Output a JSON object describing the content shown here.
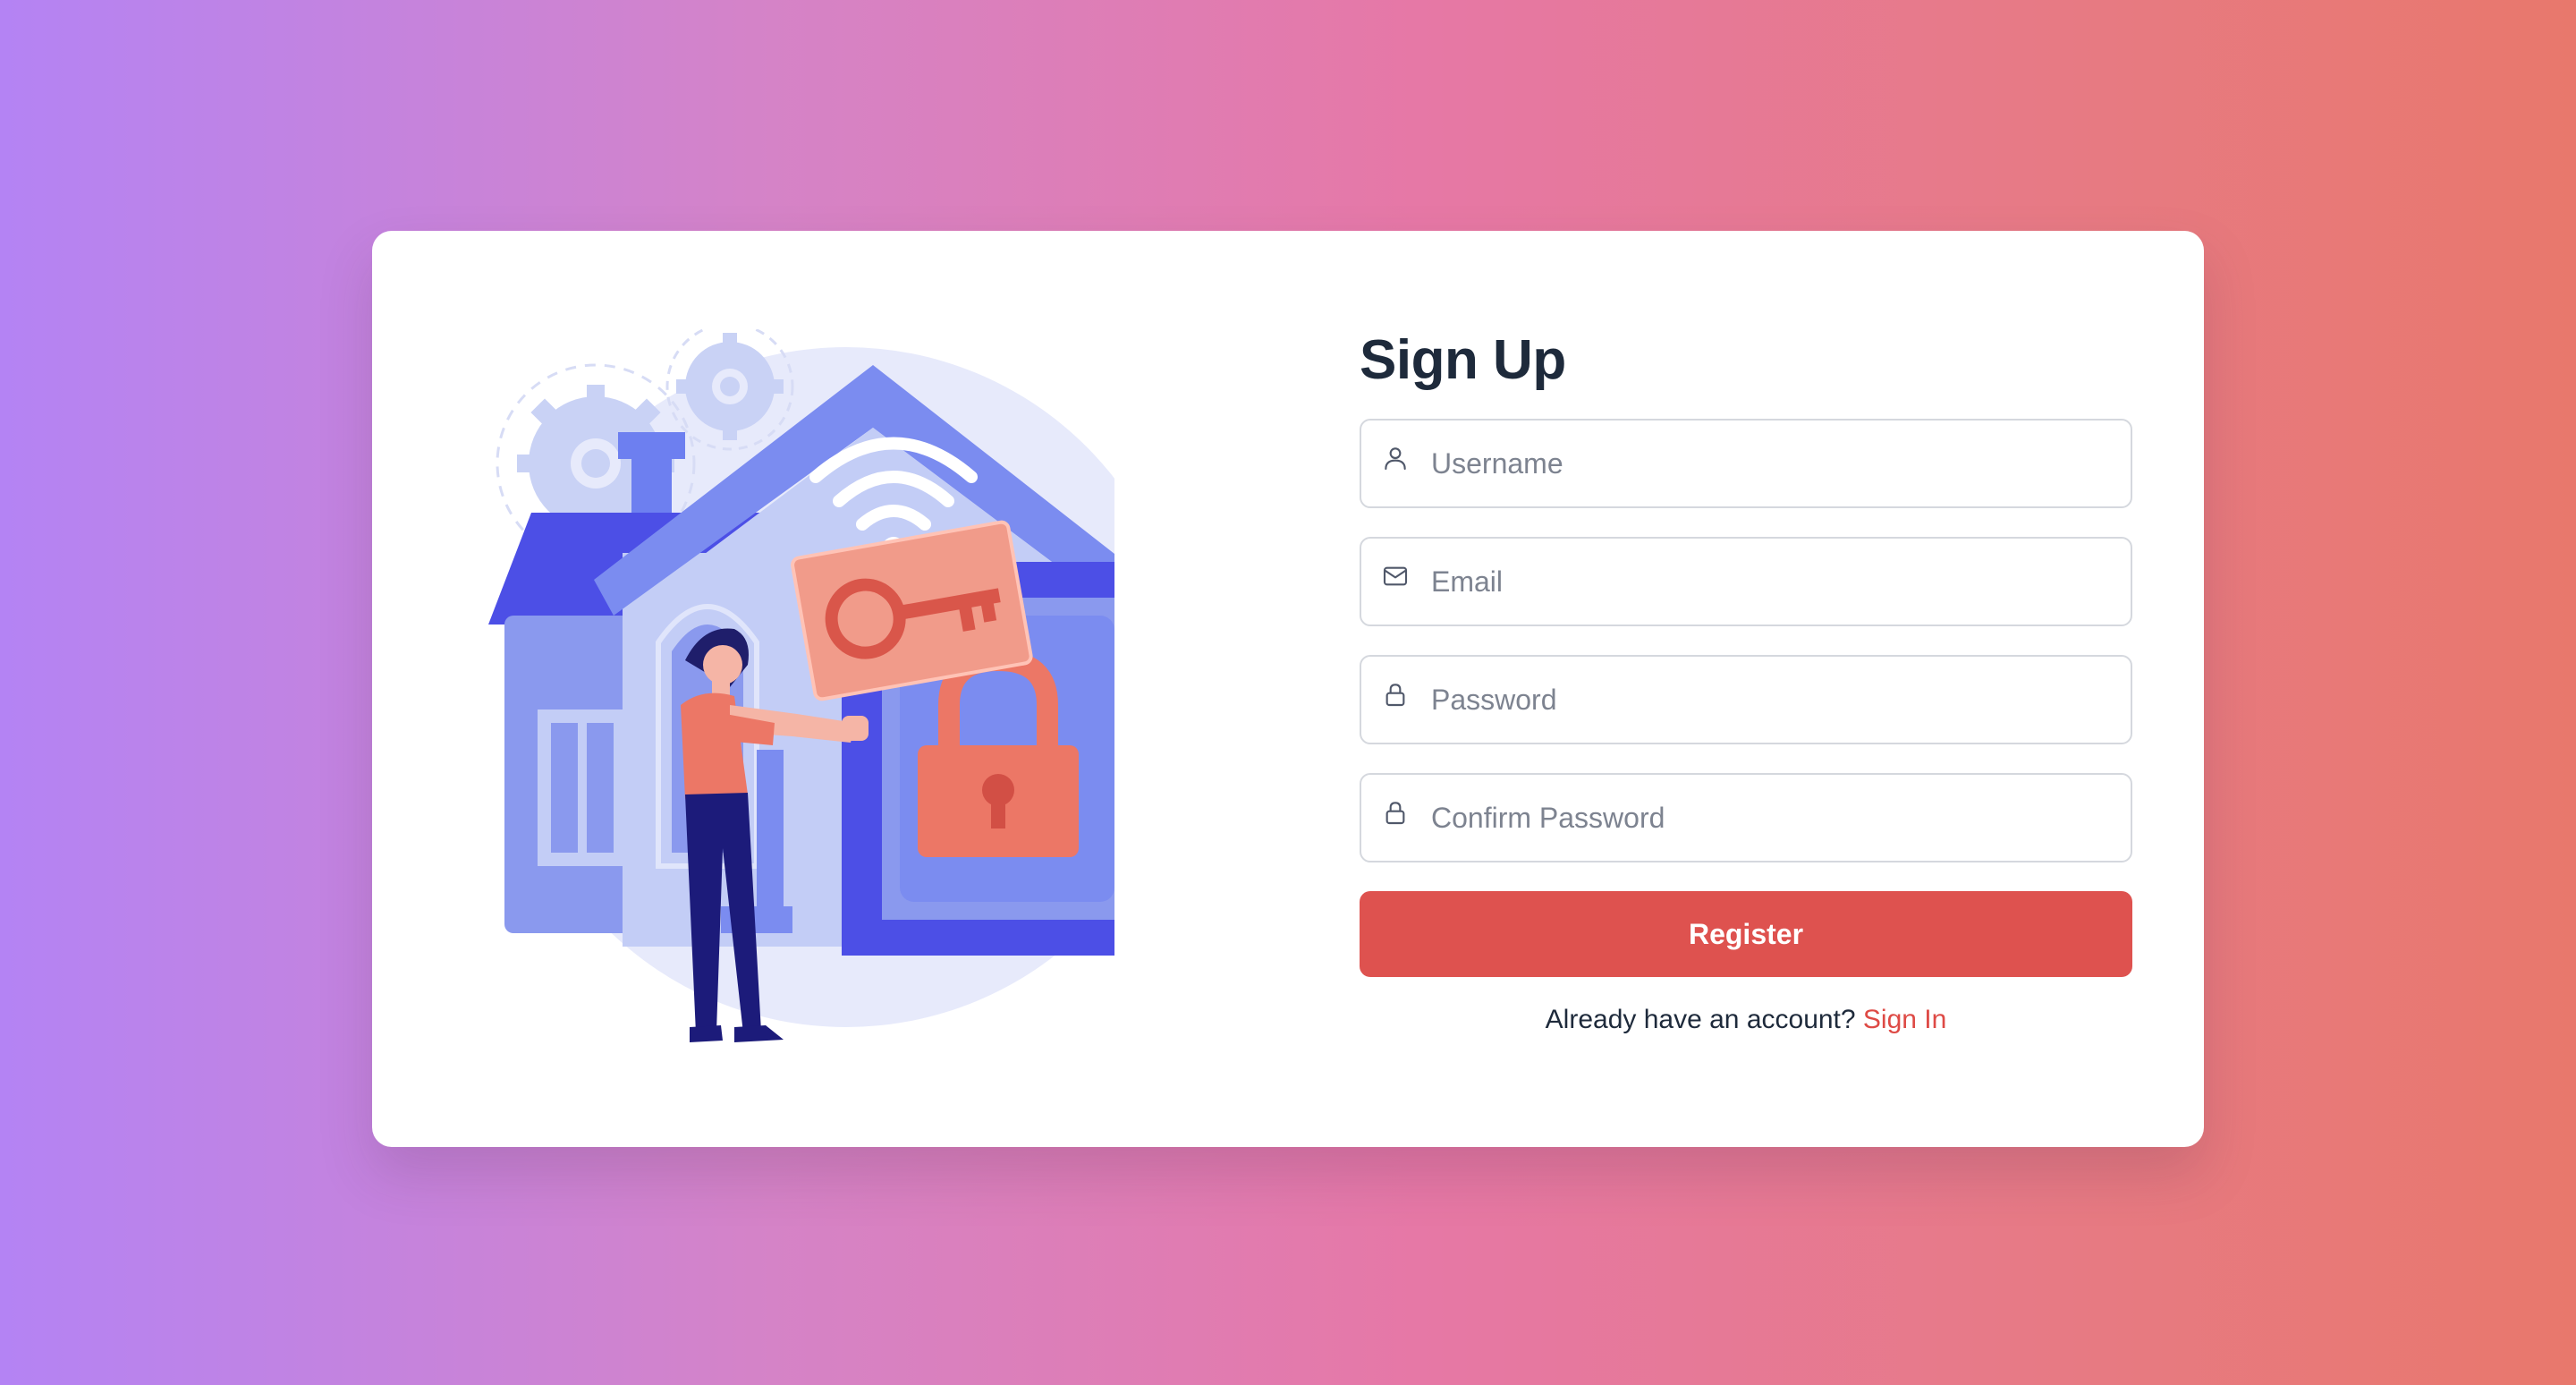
{
  "form": {
    "title": "Sign Up",
    "fields": [
      {
        "placeholder": "Username",
        "icon": "user-icon"
      },
      {
        "placeholder": "Email",
        "icon": "mail-icon"
      },
      {
        "placeholder": "Password",
        "icon": "lock-icon"
      },
      {
        "placeholder": "Confirm Password",
        "icon": "lock-icon"
      }
    ],
    "register_label": "Register",
    "signin_prompt": "Already have an account?",
    "signin_link": "Sign In"
  },
  "colors": {
    "background_gradient": [
      "#b483f4",
      "#e678a6",
      "#e8786c"
    ],
    "primary_button": "#de524f",
    "link": "#de4a45",
    "title": "#1e2a3b",
    "illustration_primary": "#4c4fe6",
    "illustration_light": "#c3cdf6",
    "illustration_accent": "#ec7766"
  }
}
